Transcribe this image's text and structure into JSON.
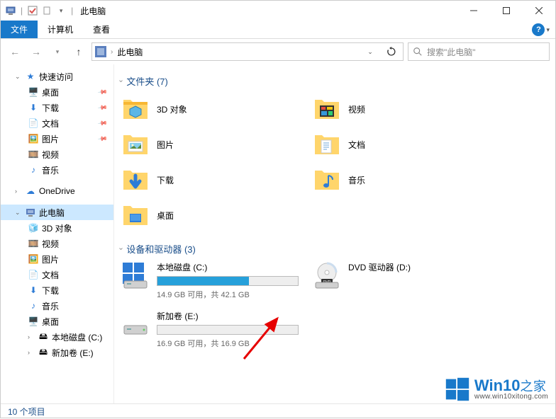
{
  "titlebar": {
    "title": "此电脑"
  },
  "window_controls": {
    "min": "—",
    "max": "☐",
    "close": "✕"
  },
  "ribbon": {
    "file": "文件",
    "computer": "计算机",
    "view": "查看",
    "help": "?"
  },
  "address": {
    "path": "此电脑"
  },
  "search": {
    "placeholder": "搜索\"此电脑\""
  },
  "sidebar": {
    "quick_access": "快速访问",
    "qa": {
      "desktop": "桌面",
      "downloads": "下载",
      "documents": "文档",
      "pictures": "图片",
      "videos": "视频",
      "music": "音乐"
    },
    "onedrive": "OneDrive",
    "this_pc": "此电脑",
    "pc": {
      "objects3d": "3D 对象",
      "videos": "视频",
      "pictures": "图片",
      "documents": "文档",
      "downloads": "下载",
      "music": "音乐",
      "desktop": "桌面",
      "drive_c": "本地磁盘 (C:)",
      "drive_e": "新加卷 (E:)"
    }
  },
  "groups": {
    "folders_title": "文件夹 (7)",
    "drives_title": "设备和驱动器 (3)"
  },
  "folders": {
    "objects3d": "3D 对象",
    "videos": "视频",
    "pictures": "图片",
    "documents": "文档",
    "downloads": "下载",
    "music": "音乐",
    "desktop": "桌面"
  },
  "drives": {
    "c": {
      "name": "本地磁盘 (C:)",
      "info": "14.9 GB 可用，共 42.1 GB",
      "fill_pct": 65
    },
    "e": {
      "name": "新加卷 (E:)",
      "info": "16.9 GB 可用，共 16.9 GB",
      "fill_pct": 0
    },
    "dvd": {
      "name": "DVD 驱动器 (D:)"
    }
  },
  "status": {
    "items": "10 个项目"
  },
  "watermark": {
    "brand": "Win10",
    "suffix": "之家",
    "url": "www.win10xitong.com"
  }
}
